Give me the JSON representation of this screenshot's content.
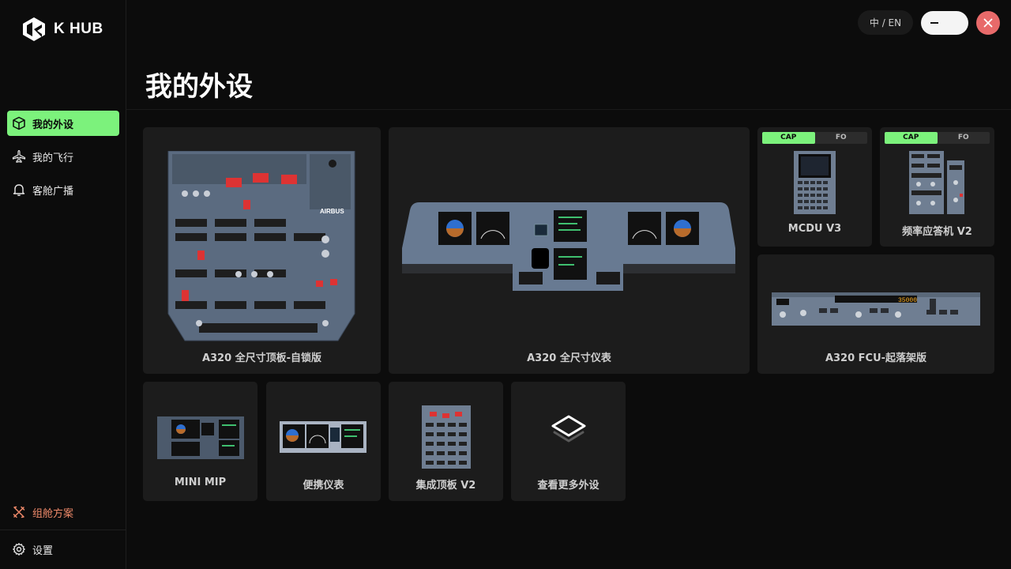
{
  "app": {
    "logo_text": "K HUB"
  },
  "sidebar": {
    "items": [
      {
        "label": "我的外设",
        "icon": "cube-icon",
        "active": true
      },
      {
        "label": "我的飞行",
        "icon": "airplane-icon",
        "active": false
      },
      {
        "label": "客舱广播",
        "icon": "bell-icon",
        "active": false
      }
    ],
    "bottom": [
      {
        "label": "组舱方案",
        "icon": "tools-icon",
        "color": "#f08a6a"
      },
      {
        "label": "设置",
        "icon": "gear-icon"
      }
    ]
  },
  "header": {
    "lang_label": "中 / EN"
  },
  "page": {
    "title": "我的外设"
  },
  "devices": [
    {
      "name": "A320 全尺寸顶板-自锁版"
    },
    {
      "name": "A320 全尺寸仪表"
    },
    {
      "name": "MCDU V3",
      "seg": [
        "CAP",
        "FO"
      ],
      "selected": "CAP"
    },
    {
      "name": "频率应答机 V2",
      "seg": [
        "CAP",
        "FO"
      ],
      "selected": "CAP"
    },
    {
      "name": "A320 FCU-起落架版"
    },
    {
      "name": "MINI MIP"
    },
    {
      "name": "便携仪表"
    },
    {
      "name": "集成顶板 V2"
    },
    {
      "name": "查看更多外设"
    }
  ],
  "overhead_badge": "AIRBUS",
  "fcu_readout": "35000",
  "colors": {
    "accent": "#7cf27c",
    "close": "#e86a6a",
    "card": "#1c1c1c",
    "highlight": "#f08a6a"
  }
}
